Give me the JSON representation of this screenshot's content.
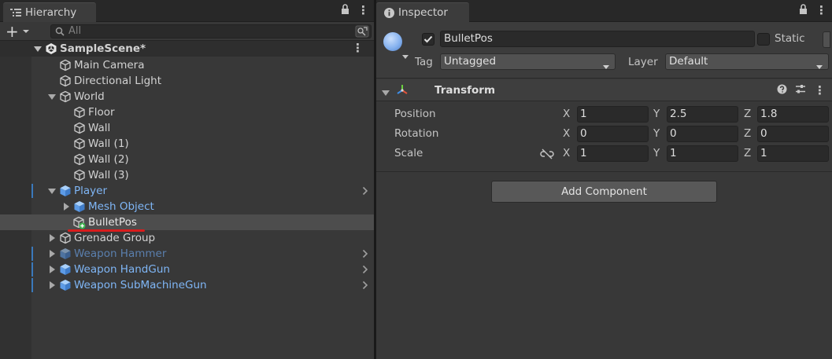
{
  "hierarchy": {
    "tab_label": "Hierarchy",
    "search_placeholder": "All",
    "add_label": "+",
    "scene": "SampleScene*",
    "items": [
      {
        "label": "Main Camera"
      },
      {
        "label": "Directional Light"
      },
      {
        "label": "World"
      },
      {
        "label": "Floor"
      },
      {
        "label": "Wall"
      },
      {
        "label": "Wall (1)"
      },
      {
        "label": "Wall (2)"
      },
      {
        "label": "Wall (3)"
      },
      {
        "label": "Player"
      },
      {
        "label": "Mesh Object"
      },
      {
        "label": "BulletPos"
      },
      {
        "label": "Grenade Group"
      },
      {
        "label": "Weapon Hammer"
      },
      {
        "label": "Weapon HandGun"
      },
      {
        "label": "Weapon SubMachineGun"
      }
    ]
  },
  "inspector": {
    "tab_label": "Inspector",
    "object_name": "BulletPos",
    "static_label": "Static",
    "tag_label": "Tag",
    "tag_value": "Untagged",
    "layer_label": "Layer",
    "layer_value": "Default",
    "component": {
      "title": "Transform",
      "position_label": "Position",
      "rotation_label": "Rotation",
      "scale_label": "Scale",
      "axis_x": "X",
      "axis_y": "Y",
      "axis_z": "Z",
      "position": {
        "x": "1",
        "y": "2.5",
        "z": "1.8"
      },
      "rotation": {
        "x": "0",
        "y": "0",
        "z": "0"
      },
      "scale": {
        "x": "1",
        "y": "1",
        "z": "1"
      }
    },
    "add_component_label": "Add Component"
  },
  "colors": {
    "prefab_text": "#7fb6f6",
    "prefab_marker": "#3a79bb",
    "underline": "#d91c1c"
  }
}
